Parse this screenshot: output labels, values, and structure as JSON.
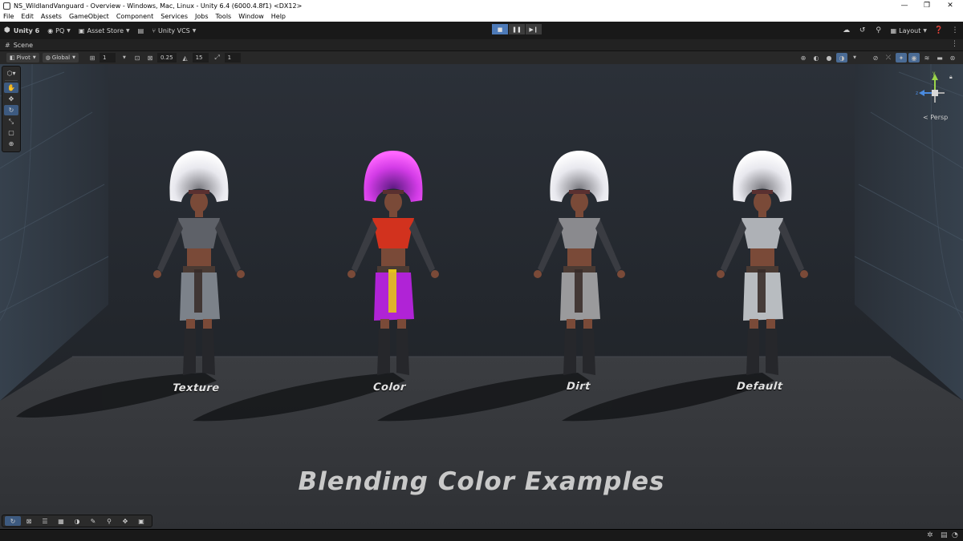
{
  "window": {
    "title": "NS_WildlandVanguard - Overview - Windows, Mac, Linux - Unity 6.4 (6000.4.8f1) <DX12>",
    "controls": [
      "—",
      "❐",
      "✕"
    ]
  },
  "menu": [
    "File",
    "Edit",
    "Assets",
    "GameObject",
    "Component",
    "Services",
    "Jobs",
    "Tools",
    "Window",
    "Help"
  ],
  "toolbar": {
    "unity_label": "Unity 6",
    "account_label": "PQ",
    "asset_store_label": "Asset Store",
    "vcs_label": "Unity VCS",
    "layout_label": "Layout"
  },
  "scene_tab": {
    "label": "Scene"
  },
  "scene_toolbar": {
    "pivot_label": "Pivot",
    "global_label": "Global",
    "grid_size": "1",
    "snap_move": "0.25",
    "snap_rotate": "15",
    "snap_scale": "1"
  },
  "viewport": {
    "character_labels": [
      "Texture",
      "Color",
      "Dirt",
      "Default"
    ],
    "title": "Blending Color Examples",
    "projection_label": "< Persp",
    "gizmo_axes": {
      "y": "y",
      "z": "z"
    },
    "colors": {
      "feather_white": "#e8e8ee",
      "feather_magenta": "#d23be6",
      "skirt_purple": "#b023d6",
      "sash_yellow": "#e3c31a",
      "top_red": "#d2321e",
      "skin": "#7a4a38"
    }
  }
}
